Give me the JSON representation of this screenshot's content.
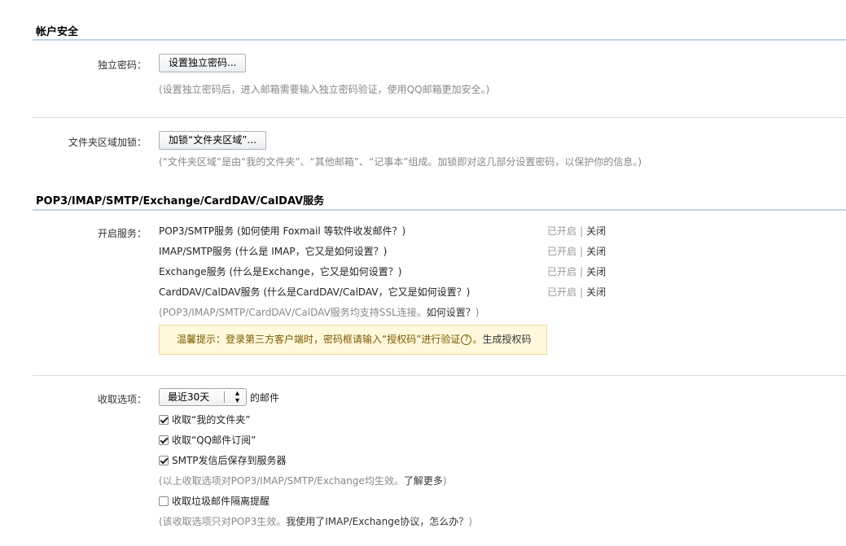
{
  "account_security": {
    "title": "帐户安全",
    "independent_password": {
      "label": "独立密码：",
      "button": "设置独立密码...",
      "hint": "(设置独立密码后，进入邮箱需要输入独立密码验证，使用QQ邮箱更加安全。)"
    },
    "folder_lock": {
      "label": "文件夹区域加锁：",
      "button": "加锁“文件夹区域”...",
      "hint": "(“文件夹区域”是由“我的文件夹”、“其他邮箱”、“记事本”组成。加锁即对这几部分设置密码，以保护你的信息。)"
    }
  },
  "protocols": {
    "title": "POP3/IMAP/SMTP/Exchange/CardDAV/CalDAV服务",
    "enable_label": "开启服务：",
    "services": [
      {
        "text": "POP3/SMTP服务 (如何使用 Foxmail 等软件收发邮件？)",
        "status": "已开启",
        "action": "关闭"
      },
      {
        "text": "IMAP/SMTP服务 (什么是 IMAP，它又是如何设置？)",
        "status": "已开启",
        "action": "关闭"
      },
      {
        "text": "Exchange服务 (什么是Exchange，它又是如何设置？)",
        "status": "已开启",
        "action": "关闭"
      },
      {
        "text": "CardDAV/CalDAV服务 (什么是CardDAV/CalDAV，它又是如何设置？)",
        "status": "已开启",
        "action": "关闭"
      }
    ],
    "ssl_hint": "(POP3/IMAP/SMTP/CardDAV/CalDAV服务均支持SSL连接。",
    "ssl_link": "如何设置？",
    "ssl_hint_end": ")",
    "tip_prefix": "温馨提示：登录第三方客户端时，密码框请输入“授权码”进行验证",
    "tip_help": "?",
    "tip_suffix": "。",
    "tip_link": "生成授权码"
  },
  "fetch_options": {
    "label": "收取选项：",
    "select_value": "最近30天",
    "select_suffix": "的邮件",
    "checkboxes": [
      {
        "label": "收取“我的文件夹”",
        "checked": true
      },
      {
        "label": "收取“QQ邮件订阅”",
        "checked": true
      },
      {
        "label": "SMTP发信后保存到服务器",
        "checked": true
      }
    ],
    "effect_hint": "(以上收取选项对POP3/IMAP/SMTP/Exchange均生效。",
    "effect_link": "了解更多",
    "effect_hint_end": ")",
    "spam_checkbox": {
      "label": "收取垃圾邮件隔离提醒",
      "checked": false
    },
    "pop3_hint": "(该收取选项只对POP3生效。",
    "pop3_link": "我使用了IMAP/Exchange协议，怎么办？",
    "pop3_hint_end": ")"
  }
}
